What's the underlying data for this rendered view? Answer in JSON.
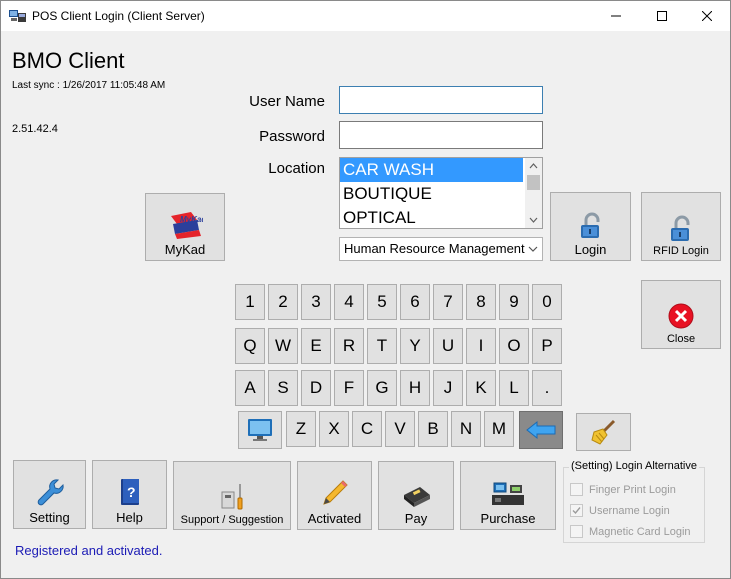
{
  "window": {
    "title": "POS Client Login (Client Server)",
    "controls": {
      "minimize": "—",
      "maximize": "☐",
      "close": "✕"
    }
  },
  "header": {
    "app_name": "BMO Client",
    "last_sync": "Last sync : 1/26/2017 11:05:48 AM",
    "version": "2.51.42.4"
  },
  "form": {
    "username_label": "User Name",
    "username_value": "",
    "password_label": "Password",
    "password_value": "",
    "location_label": "Location",
    "locations": [
      "CAR WASH",
      "BOUTIQUE",
      "OPTICAL"
    ],
    "selected_location": "CAR WASH",
    "department_selected": "Human Resource Management"
  },
  "buttons": {
    "mykad": "MyKad",
    "mykad_logo_text": "MyKad",
    "login": "Login",
    "rfid_login": "RFID Login",
    "close": "Close",
    "setting": "Setting",
    "help": "Help",
    "support": "Support / Suggestion",
    "activated": "Activated",
    "pay": "Pay",
    "purchase": "Purchase"
  },
  "keyboard": {
    "row1": [
      "1",
      "2",
      "3",
      "4",
      "5",
      "6",
      "7",
      "8",
      "9",
      "0"
    ],
    "row2": [
      "Q",
      "W",
      "E",
      "R",
      "T",
      "Y",
      "U",
      "I",
      "O",
      "P"
    ],
    "row3": [
      "A",
      "S",
      "D",
      "F",
      "G",
      "H",
      "J",
      "K",
      "L",
      "."
    ],
    "row4": [
      "Z",
      "X",
      "C",
      "V",
      "B",
      "N",
      "M"
    ]
  },
  "login_alternative": {
    "title": "(Setting) Login Alternative",
    "options": [
      {
        "label": "Finger Print Login",
        "checked": false
      },
      {
        "label": "Username Login",
        "checked": true
      },
      {
        "label": "Magnetic Card Login",
        "checked": false
      }
    ]
  },
  "status": "Registered and activated.",
  "colors": {
    "selection": "#3399ff",
    "status_text": "#1b1bb5",
    "close_red": "#e81123"
  }
}
